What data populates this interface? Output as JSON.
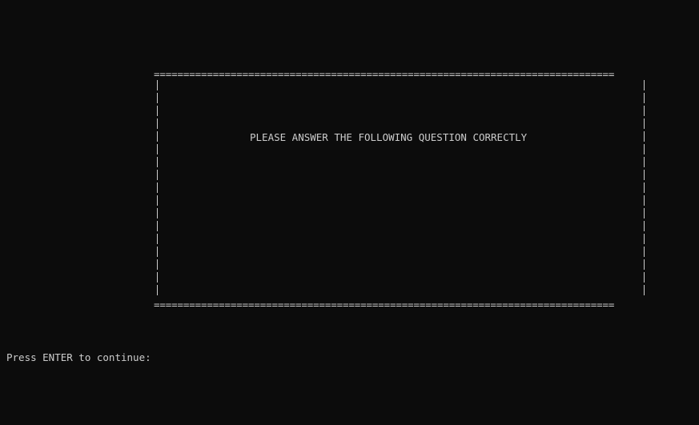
{
  "console": {
    "box": {
      "top_rule": "==============================================================================",
      "bottom_rule": "==============================================================================",
      "message": "PLEASE ANSWER THE FOLLOWING QUESTION CORRECTLY"
    },
    "prompt": "Press ENTER to continue:"
  },
  "colors": {
    "background": "#0c0c0c",
    "foreground": "#cccccc"
  }
}
